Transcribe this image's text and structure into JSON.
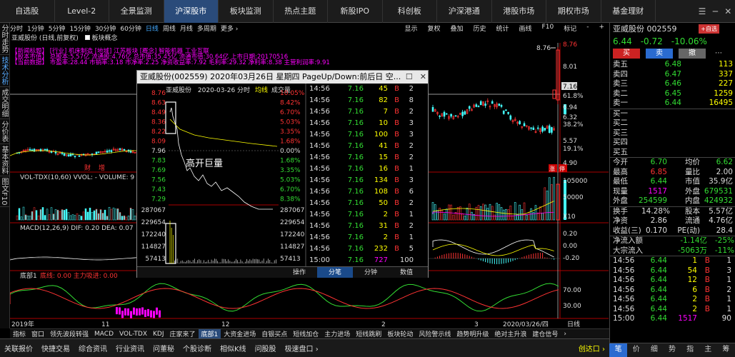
{
  "topnav": [
    "自选股",
    "Level-2",
    "全景监测",
    "沪深股市",
    "板块监测",
    "热点主题",
    "新股IPO",
    "科创板",
    "沪深港通",
    "港股市场",
    "期权市场",
    "基金理财"
  ],
  "topnav_active": 3,
  "window_controls": [
    "☰",
    "─",
    "✕"
  ],
  "left_side": [
    "分时走势",
    "技术分析",
    "成交明细",
    "分价表",
    "基本资料",
    "图文F10"
  ],
  "left_side_active": 1,
  "periods": [
    "分时",
    "1分钟",
    "5分钟",
    "15分钟",
    "30分钟",
    "60分钟",
    "日线",
    "周线",
    "月线",
    "多周期",
    "更多 ›"
  ],
  "period_active": 6,
  "toolbar_right": [
    "显示",
    "复权",
    "叠加",
    "历史",
    "统计",
    "画线",
    "F10",
    "标记",
    "-",
    "+"
  ],
  "chart": {
    "title": "亚威股份 (日线,前复权)",
    "title2": "板块概念",
    "info1": "【新闻标题】 [行业] 机床制造 [地域] 江苏板块 [概念] 智能机器 工业互联",
    "info2": "【股本市值】 总股本:5.57亿 流通股:4.76亿 总市值:35.45亿 流通市值:30.64亿 上市日期:20170516",
    "info3": "【当前数据】 市盈率:28.44 市销率:3.18 市净率:2.25 净资收益率:7.92 毛利率:29.32 净利率:8.38 主营利润率:9.91",
    "peak_label": "8.76",
    "cross_price": "7.16",
    "badge1": "涨",
    "badge2": "停",
    "k_flags": [
      "财",
      "增"
    ],
    "main_axis": [
      {
        "v": "8.76",
        "c": "#f33"
      },
      {
        "v": "8.01",
        "c": "#ddd"
      },
      {
        "v": "7.16",
        "c": "#000",
        "bg": "#ddd"
      },
      {
        "v": "61.8%",
        "c": "#ddd"
      },
      {
        "v": "6.94",
        "c": "#ddd"
      },
      {
        "v": "6.32",
        "c": "#ddd"
      },
      {
        "v": "38.2%",
        "c": "#ddd"
      },
      {
        "v": "5.57",
        "c": "#ddd"
      },
      {
        "v": "19.1%",
        "c": "#ddd"
      },
      {
        "v": "4.90",
        "c": "#ddd"
      }
    ],
    "vol_label": "VOL-TDX(10,60)  VVOL: -   VOLUME: 9",
    "vol_axis": [
      "105000",
      "50000",
      "X10"
    ],
    "macd_label": "MACD(12,26,9)  DIF: 0.20  DEA: 0.07",
    "macd_axis": [
      "0.20",
      "0.00",
      "-0.20",
      "-0.40"
    ],
    "bottom_ind_label": "底部1",
    "bottom_ind_vals": "底线: 0.00  主力吸进: 0.00",
    "bottom_axis": [
      "70.00",
      "30.00"
    ],
    "x_labels": [
      "2019年",
      "11",
      "12",
      "2",
      "3",
      "2020/03/26/四"
    ],
    "x_label_right": "日线"
  },
  "popup": {
    "title": "亚威股份(002559) 2020年03月26日 星期四 PageUp/Down:前后日 空...",
    "controls": [
      "☐",
      "✕"
    ],
    "sub_name": "亚威股份",
    "sub_date": "2020-03-26 分时",
    "sub_avg": "均线",
    "sub_vol": "成交量",
    "annotation": "高开巨量",
    "left_prices": [
      {
        "v": "8.76",
        "c": "#f33"
      },
      {
        "v": "8.63",
        "c": "#f33"
      },
      {
        "v": "8.49",
        "c": "#f33"
      },
      {
        "v": "8.36",
        "c": "#f33"
      },
      {
        "v": "8.22",
        "c": "#f33"
      },
      {
        "v": "8.09",
        "c": "#f33"
      },
      {
        "v": "7.96",
        "c": "#ddd"
      },
      {
        "v": "7.83",
        "c": "#3d3"
      },
      {
        "v": "7.69",
        "c": "#3d3"
      },
      {
        "v": "7.56",
        "c": "#3d3"
      },
      {
        "v": "7.43",
        "c": "#3d3"
      },
      {
        "v": "7.29",
        "c": "#3d3"
      }
    ],
    "right_pcts": [
      {
        "v": "10.05%",
        "c": "#f33"
      },
      {
        "v": "8.42%",
        "c": "#f33"
      },
      {
        "v": "6.70%",
        "c": "#f33"
      },
      {
        "v": "5.03%",
        "c": "#f33"
      },
      {
        "v": "3.35%",
        "c": "#f33"
      },
      {
        "v": "1.68%",
        "c": "#f33"
      },
      {
        "v": "0.00%",
        "c": "#ddd"
      },
      {
        "v": "1.68%",
        "c": "#3d3"
      },
      {
        "v": "3.35%",
        "c": "#3d3"
      },
      {
        "v": "5.03%",
        "c": "#3d3"
      },
      {
        "v": "6.70%",
        "c": "#3d3"
      },
      {
        "v": "8.38%",
        "c": "#3d3"
      }
    ],
    "vol_left": [
      "287067",
      "229654",
      "172240",
      "114827",
      "57413"
    ],
    "vol_right": [
      "287067",
      "229654",
      "172240",
      "114827",
      "57413"
    ],
    "time_axis": [
      "09:30",
      "10:30",
      "13:00",
      "14:00",
      "15:00"
    ],
    "trades": [
      [
        "14:56",
        "7.16",
        "45",
        "B",
        "2"
      ],
      [
        "14:56",
        "7.16",
        "82",
        "B",
        "8"
      ],
      [
        "14:56",
        "7.16",
        "7",
        "B",
        "2"
      ],
      [
        "14:56",
        "7.16",
        "10",
        "B",
        "3"
      ],
      [
        "14:56",
        "7.16",
        "100",
        "B",
        "3"
      ],
      [
        "14:56",
        "7.16",
        "41",
        "B",
        "2"
      ],
      [
        "14:56",
        "7.16",
        "15",
        "B",
        "2"
      ],
      [
        "14:56",
        "7.16",
        "16",
        "B",
        "1"
      ],
      [
        "14:56",
        "7.16",
        "134",
        "B",
        "3"
      ],
      [
        "14:56",
        "7.16",
        "108",
        "B",
        "6"
      ],
      [
        "14:56",
        "7.16",
        "50",
        "B",
        "2"
      ],
      [
        "14:56",
        "7.16",
        "2",
        "B",
        "1"
      ],
      [
        "14:56",
        "7.16",
        "31",
        "B",
        "2"
      ],
      [
        "14:56",
        "7.16",
        "2",
        "B",
        "1"
      ],
      [
        "14:56",
        "7.16",
        "232",
        "B",
        "5"
      ],
      [
        "15:00",
        "7.16",
        "727",
        "",
        "100"
      ]
    ],
    "tabs": [
      "操作",
      "分笔",
      "分钟",
      "数值"
    ],
    "tab_active": 1
  },
  "right": {
    "name": "亚威股份 002559",
    "add_btn": "+自选",
    "price": "6.44",
    "change": "-0.72",
    "pct": "-10.06%",
    "buy_btn": "买",
    "sell_btn": "卖",
    "cancel_btn": "撤",
    "more_btn": "⋯",
    "asks": [
      [
        "卖五",
        "6.48",
        "113"
      ],
      [
        "卖四",
        "6.47",
        "337"
      ],
      [
        "卖三",
        "6.46",
        "227"
      ],
      [
        "卖二",
        "6.45",
        "1259"
      ],
      [
        "卖一",
        "6.44",
        "16495"
      ]
    ],
    "bids": [
      "买一",
      "买二",
      "买三",
      "买四",
      "买五"
    ],
    "stats": [
      [
        "今开",
        "6.70",
        "均价",
        "6.62"
      ],
      [
        "最高",
        "6.85",
        "量比",
        "2.00"
      ],
      [
        "最低",
        "6.44",
        "市值",
        "35.9亿"
      ],
      [
        "现量",
        "1517",
        "外盘",
        "679531"
      ],
      [
        "外盘",
        "254599",
        "内盘",
        "424932"
      ]
    ],
    "stats2": [
      [
        "换手",
        "14.28%",
        "股本",
        "5.57亿"
      ],
      [
        "净资",
        "2.86",
        "流通",
        "4.76亿"
      ],
      [
        "收益(三)",
        "0.170",
        "PE(动)",
        "28.4"
      ]
    ],
    "flow": [
      [
        "净流入额",
        "-1.14亿",
        "-25%"
      ],
      [
        "大宗流入",
        "-5063万",
        "-11%"
      ]
    ],
    "ticks": [
      [
        "14:56",
        "6.44",
        "1",
        "B",
        "1"
      ],
      [
        "14:56",
        "6.44",
        "54",
        "B",
        "3"
      ],
      [
        "14:56",
        "6.44",
        "12",
        "B",
        "1"
      ],
      [
        "14:56",
        "6.44",
        "6",
        "B",
        "2"
      ],
      [
        "14:56",
        "6.44",
        "2",
        "B",
        "1"
      ],
      [
        "14:56",
        "6.44",
        "2",
        "B",
        "1"
      ],
      [
        "15:00",
        "6.44",
        "1517",
        "",
        "90"
      ]
    ],
    "bottom_tabs": [
      "笔",
      "价",
      "细",
      "势",
      "指",
      "主",
      "筹"
    ]
  },
  "bottom_indicators": [
    "指标",
    "窗口",
    "领先波段转强",
    "MACD",
    "VOL-TDX",
    "KDJ",
    "庄家来了",
    "底部1",
    "大资金进场",
    "自银买点",
    "短线加仓",
    "主力进场",
    "短线跳刷",
    "板块轮动",
    "风险警示线",
    "趋势明升级",
    "绝对主升浪",
    "建仓信号",
    "›"
  ],
  "bottom_indicators_active": 7,
  "statusbar": [
    "关联报价",
    "快捷交易",
    "综合资讯",
    "行业资讯",
    "问董秘",
    "个股诊断",
    "相似K线",
    "问股股",
    "极速盘口 ›"
  ],
  "statusbar_right": "创达口 ›"
}
